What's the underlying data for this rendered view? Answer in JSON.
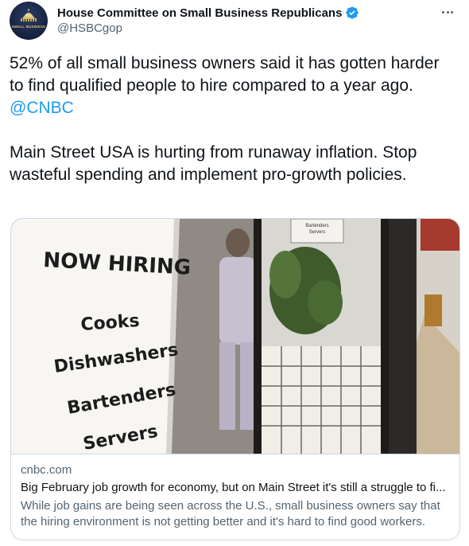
{
  "author": {
    "display_name": "House Committee on Small Business Republicans",
    "handle": "@HSBCgop",
    "avatar_caption": "SMALL BUSINESS",
    "verified": true
  },
  "tweet": {
    "paragraph1_text": "52% of all small business owners said it has gotten harder to find qualified people to hire compared to a year ago.",
    "paragraph1_mention": "@CNBC",
    "paragraph2_text": "Main Street USA is hurting from runaway inflation. Stop wasteful spending and implement pro-growth policies."
  },
  "card": {
    "domain": "cnbc.com",
    "title": "Big February job growth for economy, but on Main Street it's still a struggle to fi...",
    "description": "While job gains are being seen across the U.S., small business owners say that the hiring environment is not getting better and it's hard to find good workers.",
    "image": {
      "sign_heading": "NOW HIRING",
      "sign_items": [
        "Cooks",
        "Dishwashers",
        "Bartenders",
        "Servers"
      ],
      "small_note_lines": [
        "Bartenders",
        "Servers"
      ]
    }
  },
  "colors": {
    "accent": "#1d9bf0",
    "text_primary": "#0f1419",
    "text_secondary": "#536471",
    "border": "#cfd9de"
  },
  "icons": {
    "verified": "verified-badge-icon",
    "more": "more-horizontal-icon"
  }
}
